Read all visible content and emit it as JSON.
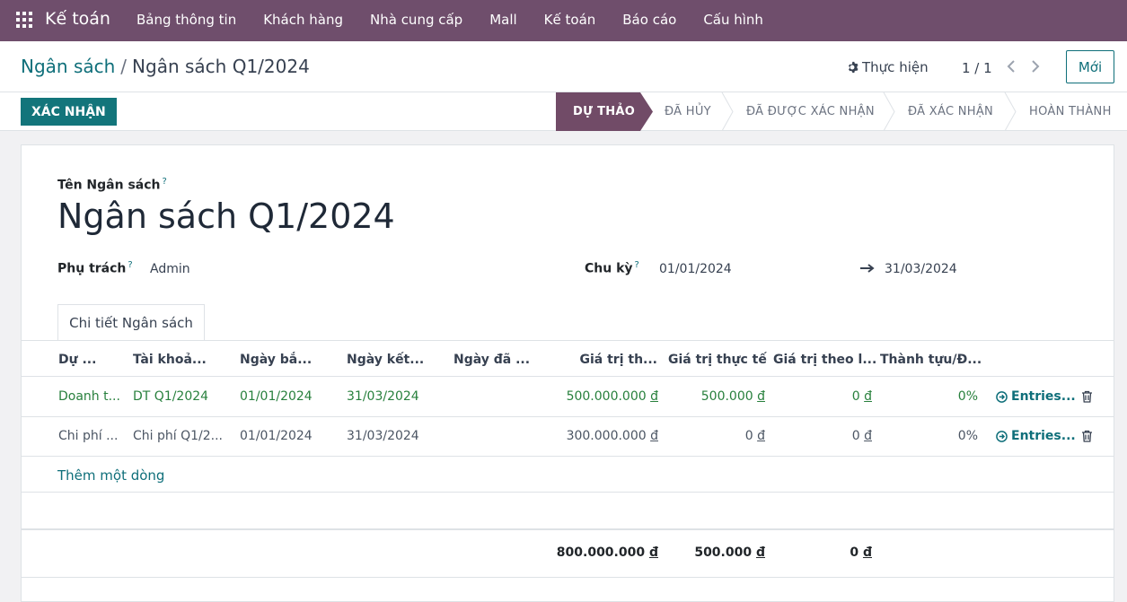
{
  "topbar": {
    "app_name": "Kế toán",
    "menu": [
      "Bảng thông tin",
      "Khách hàng",
      "Nhà cung cấp",
      "Mall",
      "Kế toán",
      "Báo cáo",
      "Cấu hình"
    ]
  },
  "breadcrumb": {
    "parent": "Ngân sách",
    "separator": "/",
    "current": "Ngân sách Q1/2024"
  },
  "controls": {
    "action_label": "Thực hiện",
    "pager": "1 / 1",
    "new_label": "Mới"
  },
  "statusbar": {
    "confirm_label": "XÁC NHẬN",
    "stages": [
      {
        "label": "DỰ THẢO",
        "active": true
      },
      {
        "label": "ĐÃ HỦY",
        "active": false
      },
      {
        "label": "ĐÃ ĐƯỢC XÁC NHẬN",
        "active": false
      },
      {
        "label": "ĐÃ XÁC NHẬN",
        "active": false
      },
      {
        "label": "HOÀN THÀNH",
        "active": false
      }
    ]
  },
  "form": {
    "name_label": "Tên Ngân sách",
    "help_mark": "?",
    "name_value": "Ngân sách Q1/2024",
    "responsible_label": "Phụ trách",
    "responsible_value": "Admin",
    "period_label": "Chu kỳ",
    "period_start": "01/01/2024",
    "period_end": "31/03/2024"
  },
  "tab": {
    "label": "Chi tiết Ngân sách"
  },
  "table": {
    "headers": [
      "Dự ...",
      "Tài khoả...",
      "Ngày bắ...",
      "Ngày kết...",
      "Ngày đã ...",
      "Giá trị th...",
      "Giá trị thực tế",
      "Giá trị theo l...",
      "Thành tựu/Đ..."
    ],
    "rows": [
      {
        "c0": "Doanh t...",
        "c1": "DT Q1/2024",
        "c2": "01/01/2024",
        "c3": "31/03/2024",
        "c4": "",
        "c5": "500.000.000",
        "c6": "500.000",
        "c7": "0",
        "c8": "0%",
        "entries": "Entries..."
      },
      {
        "c0": "Chi phí ...",
        "c1": "Chi phí Q1/2...",
        "c2": "01/01/2024",
        "c3": "31/03/2024",
        "c4": "",
        "c5": "300.000.000",
        "c6": "0",
        "c7": "0",
        "c8": "0%",
        "entries": "Entries..."
      }
    ],
    "currency": "đ",
    "add_line": "Thêm một dòng",
    "totals": {
      "planned": "800.000.000",
      "actual": "500.000",
      "theoretical": "0"
    }
  },
  "colors": {
    "topbar": "#6f4e6c",
    "primary": "#13757b",
    "stage_active": "#714b67",
    "positive": "#28803d"
  }
}
